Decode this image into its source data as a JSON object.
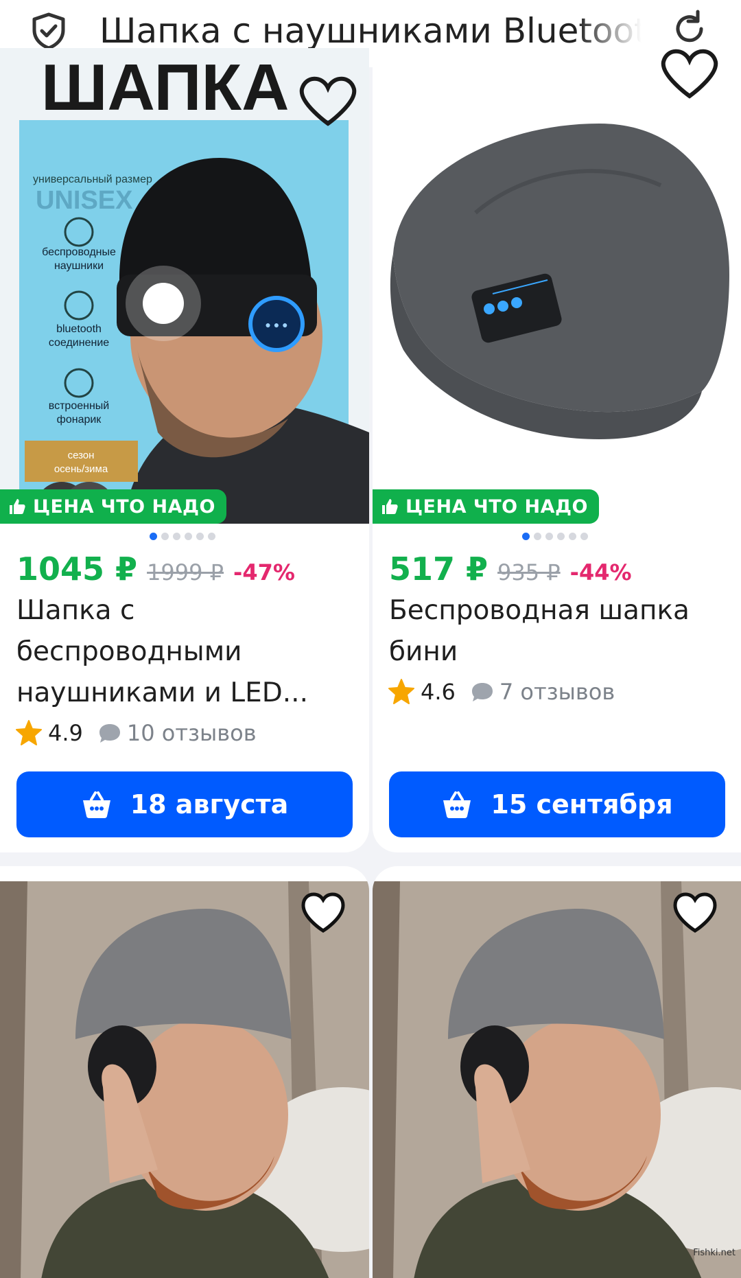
{
  "header": {
    "title": "Шапка с наушниками Bluetooth"
  },
  "products": [
    {
      "badge": "ЦЕНА ЧТО НАДО",
      "price": "1045 ₽",
      "old_price": "1999 ₽",
      "discount": "-47%",
      "title": "Шапка с беспроводными наушниками и LED...",
      "rating": "4.9",
      "reviews": "10 отзывов",
      "delivery": "18 августа",
      "image_text": {
        "brand": "ШАПКА",
        "size": "универсальный размер",
        "unisex": "UNISEX",
        "feature_1": "беспроводные наушники",
        "feature_2": "bluetooth соединение",
        "feature_3": "встроенный фонарик",
        "season": "сезон осень/зима"
      }
    },
    {
      "badge": "ЦЕНА ЧТО НАДО",
      "price": "517 ₽",
      "old_price": "935 ₽",
      "discount": "-44%",
      "title": "Беспроводная шапка бини",
      "rating": "4.6",
      "reviews": "7 отзывов",
      "delivery": "15 сентября"
    }
  ],
  "watermark": "Fishki.net",
  "colors": {
    "price_green": "#12b04d",
    "discount_pink": "#e4286e",
    "button_blue": "#005bff",
    "badge_green": "#10b04c",
    "star": "#f7a600"
  }
}
